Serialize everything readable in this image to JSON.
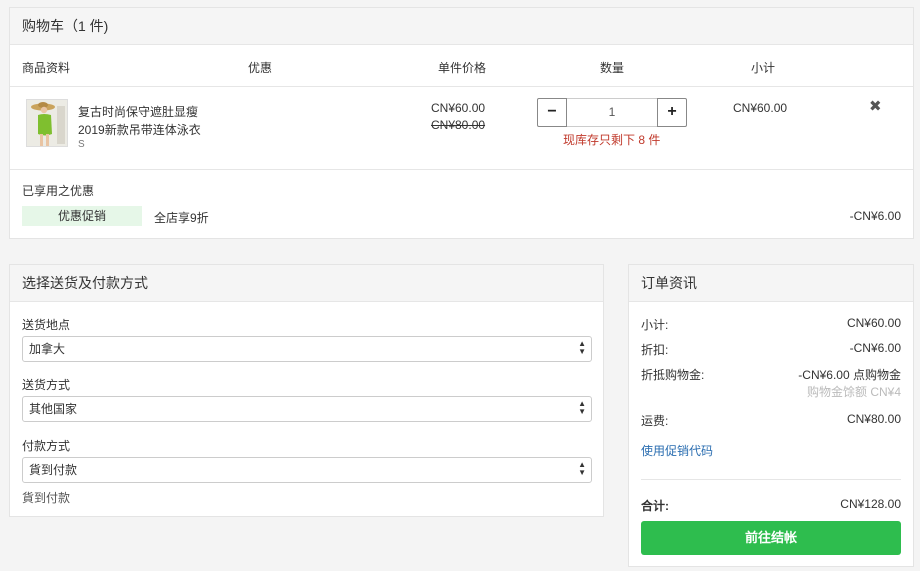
{
  "cart": {
    "title": "购物车（1 件)",
    "columns": {
      "product": "商品资料",
      "discount": "优惠",
      "unit_price": "单件价格",
      "quantity": "数量",
      "subtotal": "小计"
    },
    "items": [
      {
        "name": "复古时尚保守遮肚显瘦2019新款吊带连体泳衣",
        "variant": "S",
        "price": "CN¥60.00",
        "original_price": "CN¥80.00",
        "quantity": "1",
        "stock_warning": "现库存只剩下 8 件",
        "subtotal": "CN¥60.00",
        "minus_icon": "minus-icon",
        "plus_icon": "plus-icon",
        "remove_icon": "close-icon"
      }
    ],
    "applied_label": "已享用之优惠",
    "promo": {
      "badge": "优惠促销",
      "description": "全店享9折",
      "amount": "-CN¥6.00",
      "badge_color": "#e6f7e8"
    }
  },
  "shipping": {
    "title": "选择送货及付款方式",
    "location_label": "送货地点",
    "location_value": "加拿大",
    "method_label": "送货方式",
    "method_value": "其他国家",
    "payment_label": "付款方式",
    "payment_value": "貨到付款",
    "payment_note": "貨到付款"
  },
  "summary": {
    "title": "订单资讯",
    "subtotal_label": "小计:",
    "subtotal_value": "CN¥60.00",
    "discount_label": "折扣:",
    "discount_value": "-CN¥6.00",
    "credit_label": "折抵购物金:",
    "credit_value": "-CN¥6.00 点购物金",
    "credit_balance": "购物金馀额 CN¥4",
    "shipping_label": "运费:",
    "shipping_value": "CN¥80.00",
    "promo_code_link": "使用促销代码",
    "total_label": "合计:",
    "total_value": "CN¥128.00",
    "checkout_label": "前往结帐",
    "checkout_color": "#2ebd4e",
    "link_color": "#2a6db0"
  }
}
